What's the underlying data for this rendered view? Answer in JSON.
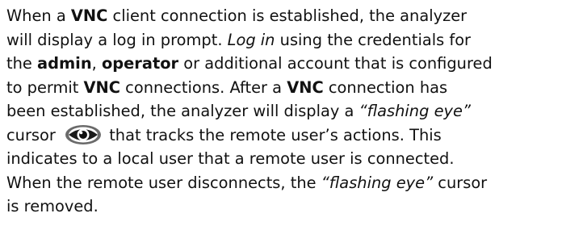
{
  "paragraph": {
    "l1": {
      "a": "When a ",
      "b": "VNC",
      "c": " client connection is established, the analyzer"
    },
    "l2": {
      "a": "will display a log in prompt. ",
      "b": "Log in",
      "c": " using the credentials for"
    },
    "l3": {
      "a": "the ",
      "b": "admin",
      "c": ", ",
      "d": "operator",
      "e": " or additional account that is configured"
    },
    "l4": {
      "a": "to permit ",
      "b": "VNC",
      "c": " connections. After a ",
      "d": "VNC",
      "e": " connection has"
    },
    "l5": {
      "a": "been established, the analyzer will display a ",
      "b": "“flashing eye”"
    },
    "l6": {
      "a": "cursor ",
      "icon": "eye-icon",
      "b": " that tracks the remote user’s actions. This"
    },
    "l7": "indicates to a local user that a remote user is connected.",
    "l8": {
      "a": "When the remote user disconnects, the ",
      "b": "“flashing eye”",
      "c": " cursor"
    },
    "l9": "is removed."
  }
}
